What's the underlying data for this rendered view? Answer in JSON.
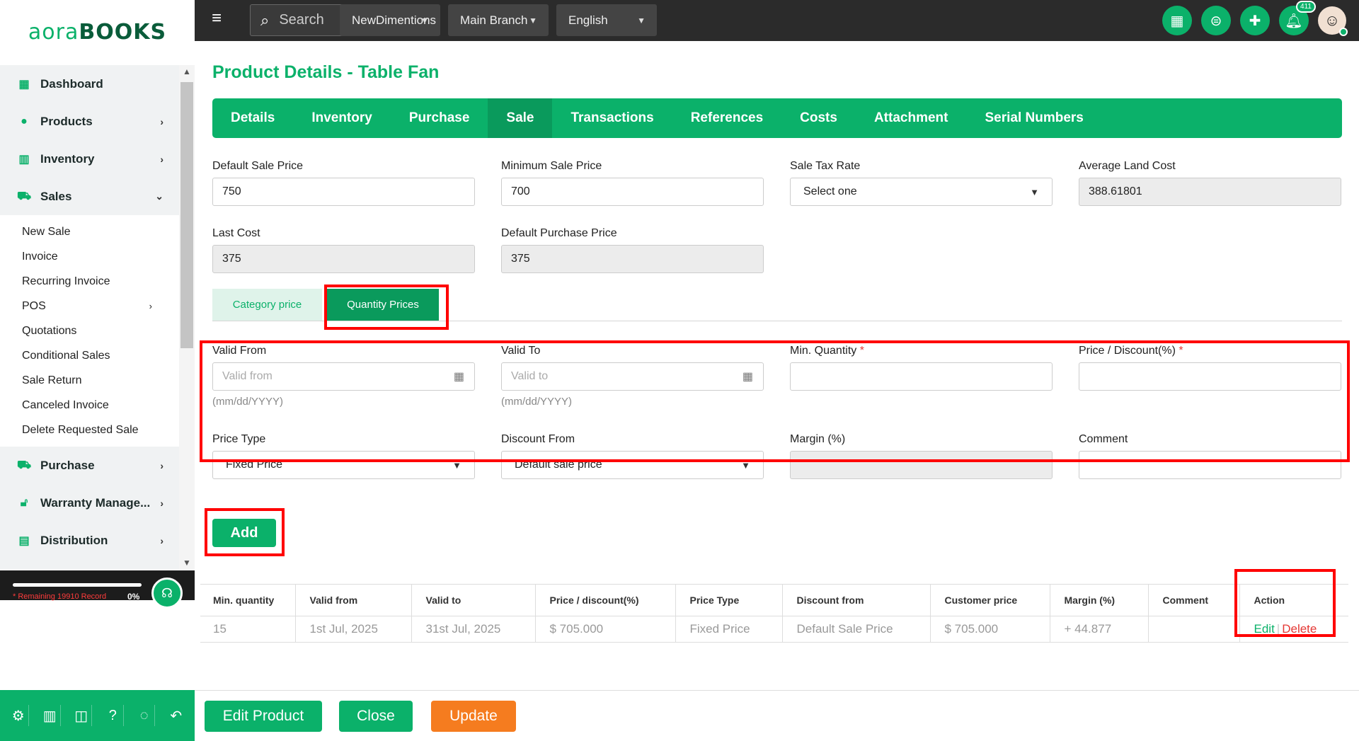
{
  "app": {
    "logo_left": "aora",
    "logo_right": "BOOKS"
  },
  "sidebar": {
    "items": [
      {
        "label": "Dashboard",
        "icon": "grid-icon"
      },
      {
        "label": "Products",
        "icon": "products-icon"
      },
      {
        "label": "Inventory",
        "icon": "warehouse-icon"
      },
      {
        "label": "Sales",
        "icon": "cart-icon"
      }
    ],
    "sales_sub": [
      "New Sale",
      "Invoice",
      "Recurring Invoice",
      "POS",
      "Quotations",
      "Conditional Sales",
      "Sale Return",
      "Canceled Invoice",
      "Delete Requested Sale"
    ],
    "more_items": [
      {
        "label": "Purchase",
        "icon": "cart-icon"
      },
      {
        "label": "Warranty Manage...",
        "icon": "lock-icon"
      },
      {
        "label": "Distribution",
        "icon": "document-icon"
      }
    ],
    "remaining": "* Remaining 19910 Record",
    "percent": "0%"
  },
  "topbar": {
    "search_placeholder": "Search",
    "company": "NewDimentions",
    "branch": "Main Branch",
    "language": "English",
    "notification_count": "411"
  },
  "page": {
    "title": "Product Details - Table Fan",
    "tabs": [
      "Details",
      "Inventory",
      "Purchase",
      "Sale",
      "Transactions",
      "References",
      "Costs",
      "Attachment",
      "Serial Numbers"
    ],
    "active_tab": "Sale"
  },
  "sale": {
    "default_sale_price_label": "Default Sale Price",
    "default_sale_price": "750",
    "min_sale_price_label": "Minimum Sale Price",
    "min_sale_price": "700",
    "sale_tax_rate_label": "Sale Tax Rate",
    "sale_tax_rate": "Select one",
    "avg_land_cost_label": "Average Land Cost",
    "avg_land_cost": "388.61801",
    "last_cost_label": "Last Cost",
    "last_cost": "375",
    "default_purchase_price_label": "Default Purchase Price",
    "default_purchase_price": "375"
  },
  "subtabs": {
    "category": "Category price",
    "quantity": "Quantity Prices"
  },
  "qty_form": {
    "valid_from_label": "Valid From",
    "valid_from_ph": "Valid from",
    "valid_to_label": "Valid To",
    "valid_to_ph": "Valid to",
    "date_hint": "(mm/dd/YYYY)",
    "min_qty_label": "Min. Quantity",
    "price_disc_label": "Price / Discount(%)",
    "price_type_label": "Price Type",
    "price_type": "Fixed Price",
    "discount_from_label": "Discount From",
    "discount_from": "Default sale price",
    "margin_label": "Margin (%)",
    "comment_label": "Comment",
    "add_label": "Add"
  },
  "table": {
    "headers": [
      "Min. quantity",
      "Valid from",
      "Valid to",
      "Price / discount(%)",
      "Price Type",
      "Discount from",
      "Customer price",
      "Margin (%)",
      "Comment",
      "Action"
    ],
    "rows": [
      [
        "15",
        "1st Jul, 2025",
        "31st Jul, 2025",
        "$ 705.000",
        "Fixed Price",
        "Default Sale Price",
        "$ 705.000",
        "+ 44.877",
        ""
      ]
    ],
    "edit": "Edit",
    "delete": "Delete"
  },
  "footer": {
    "edit_product": "Edit Product",
    "close": "Close",
    "update": "Update"
  },
  "colors": {
    "accent": "#0bb16a",
    "dark": "#2b2b2b",
    "highlight": "#ff0000",
    "orange": "#f57c1f"
  }
}
